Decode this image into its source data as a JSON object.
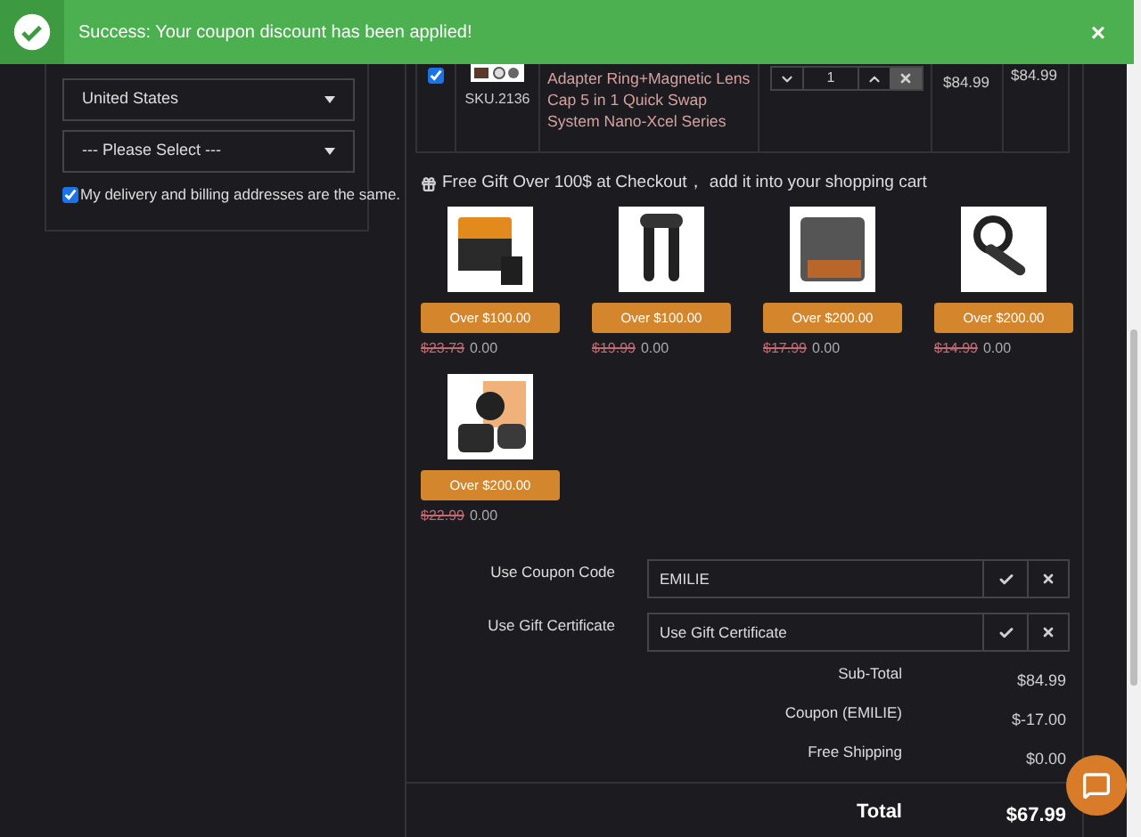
{
  "banner": {
    "message": "Success: Your coupon discount has been applied!",
    "close": "×"
  },
  "address": {
    "country": "United States",
    "region": "--- Please Select ---",
    "same_address": {
      "label": "My delivery and billing addresses are the same.",
      "checked": true
    }
  },
  "cart_row": {
    "checked": true,
    "sku": "SKU.2136",
    "name": "Adapter Ring+Magnetic Lens Cap 5 in 1 Quick Swap System Nano-Xcel Series",
    "quantity": "1",
    "unit_price": "$84.99",
    "total": "$84.99"
  },
  "gift_heading": "Free Gift Over 100$ at Checkout， add it into your shopping cart",
  "gifts": [
    {
      "button": "Over $100.00",
      "old_price": "$23.73",
      "price": "0.00"
    },
    {
      "button": "Over $100.00",
      "old_price": "$19.99",
      "price": "0.00"
    },
    {
      "button": "Over $200.00",
      "old_price": "$17.99",
      "price": "0.00"
    },
    {
      "button": "Over $200.00",
      "old_price": "$14.99",
      "price": "0.00"
    },
    {
      "button": "Over $200.00",
      "old_price": "$22.99",
      "price": "0.00"
    }
  ],
  "coupon": {
    "label": "Use Coupon Code",
    "value": "EMILIE"
  },
  "gift_certificate": {
    "label": "Use Gift Certificate",
    "placeholder": "Use Gift Certificate"
  },
  "totals": [
    {
      "label": "Sub-Total",
      "value": "$84.99"
    },
    {
      "label": "Coupon (EMILIE)",
      "value": "$-17.00"
    },
    {
      "label": "Free Shipping",
      "value": "$0.00"
    }
  ],
  "total": {
    "label": "Total",
    "value": "$67.99"
  }
}
